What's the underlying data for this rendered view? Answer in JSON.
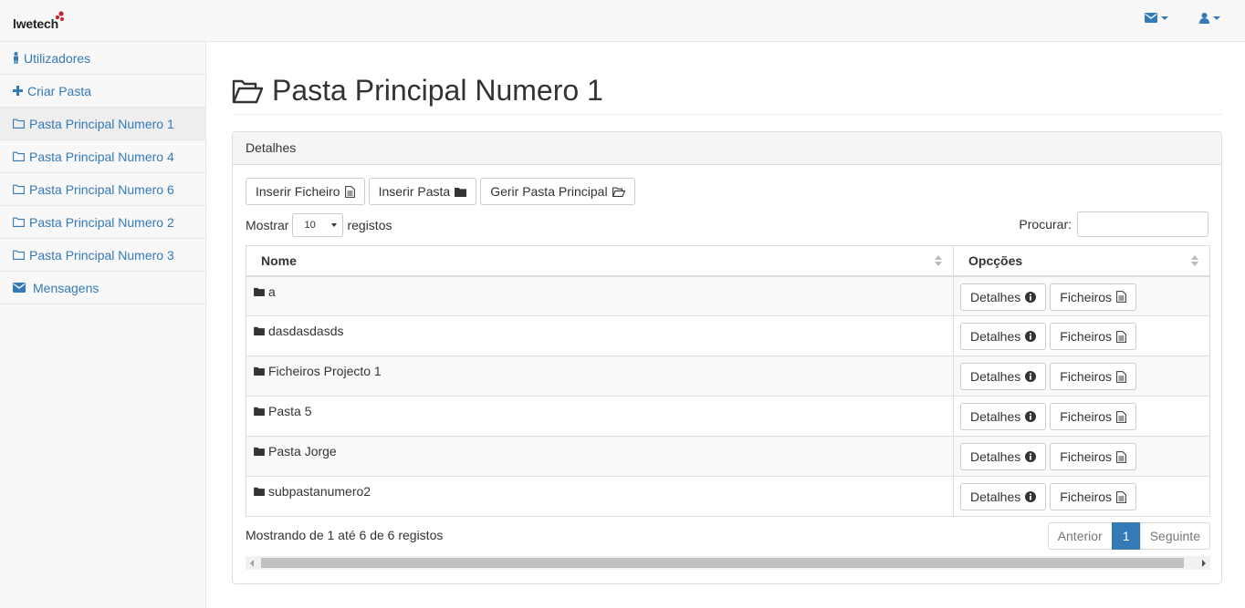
{
  "brand": {
    "name": "lwetech"
  },
  "nav": {
    "mail_icon": "envelope-icon",
    "user_icon": "user-icon"
  },
  "sidebar": {
    "items": [
      {
        "label": "Utilizadores",
        "icon": "user-icon"
      },
      {
        "label": "Criar Pasta",
        "icon": "plus-icon"
      },
      {
        "label": "Pasta Principal Numero 1",
        "icon": "folder-open-outline-icon",
        "active": true
      },
      {
        "label": "Pasta Principal Numero 4",
        "icon": "folder-outline-icon"
      },
      {
        "label": "Pasta Principal Numero 6",
        "icon": "folder-outline-icon"
      },
      {
        "label": "Pasta Principal Numero 2",
        "icon": "folder-outline-icon"
      },
      {
        "label": "Pasta Principal Numero 3",
        "icon": "folder-outline-icon"
      },
      {
        "label": "Mensagens",
        "icon": "envelope-icon"
      }
    ]
  },
  "page": {
    "title": "Pasta Principal Numero 1"
  },
  "panel": {
    "heading": "Detalhes",
    "toolbar": {
      "insert_file": "Inserir Ficheiro",
      "insert_folder": "Inserir Pasta",
      "manage_main": "Gerir Pasta Principal"
    },
    "length": {
      "prefix": "Mostrar",
      "value": "10",
      "suffix": "registos"
    },
    "search": {
      "label": "Procurar:",
      "value": ""
    },
    "table": {
      "columns": [
        "Nome",
        "Opcções"
      ],
      "rows": [
        {
          "name": "a",
          "details": "Detalhes",
          "files": "Ficheiros"
        },
        {
          "name": "dasdasdasds",
          "details": "Detalhes",
          "files": "Ficheiros"
        },
        {
          "name": "Ficheiros Projecto 1",
          "details": "Detalhes",
          "files": "Ficheiros"
        },
        {
          "name": "Pasta 5",
          "details": "Detalhes",
          "files": "Ficheiros"
        },
        {
          "name": "Pasta Jorge",
          "details": "Detalhes",
          "files": "Ficheiros"
        },
        {
          "name": "subpastanumero2",
          "details": "Detalhes",
          "files": "Ficheiros"
        }
      ]
    },
    "info": "Mostrando de 1 até 6 de 6 registos",
    "pager": {
      "prev": "Anterior",
      "current": "1",
      "next": "Seguinte"
    }
  },
  "colors": {
    "link": "#337ab7",
    "active_page": "#337ab7",
    "brand_accent": "#c9252b"
  }
}
